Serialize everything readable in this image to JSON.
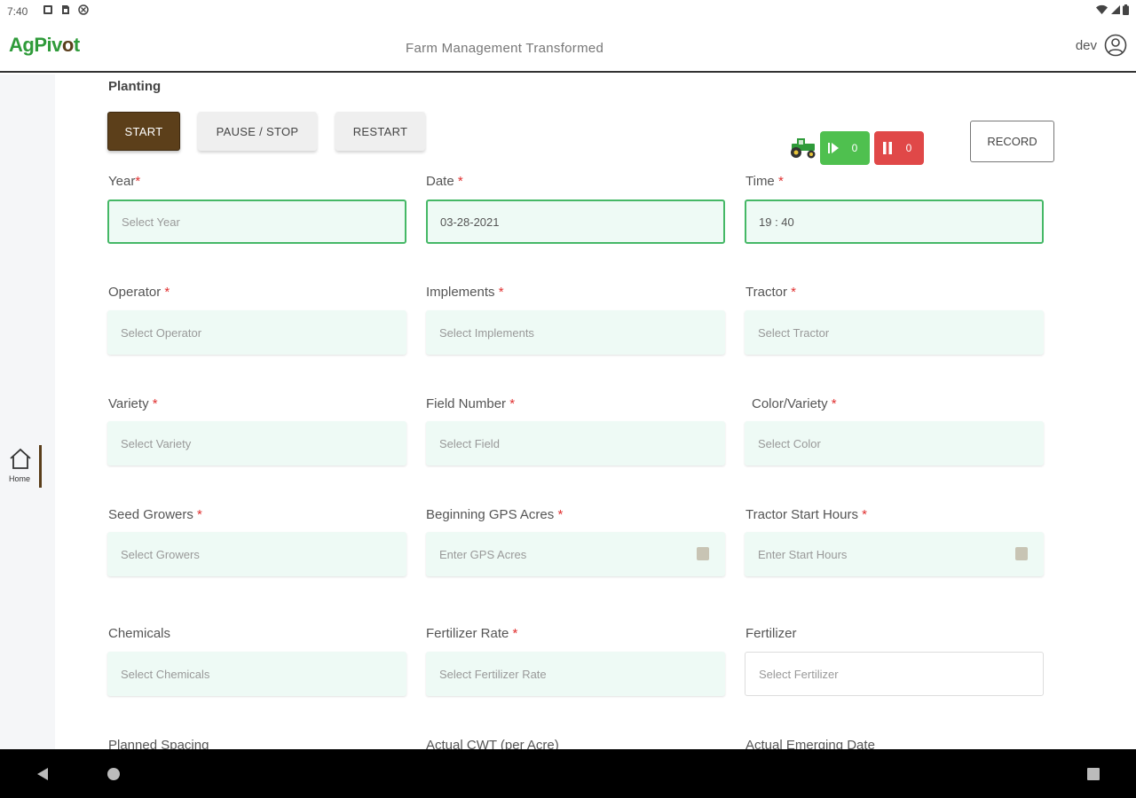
{
  "status_bar": {
    "time": "7:40"
  },
  "app": {
    "logo_part1": "Ag",
    "logo_part2": "Piv",
    "logo_part3": "o",
    "logo_part4": "t",
    "tagline": "Farm Management Transformed",
    "user_name": "dev",
    "brand_color": "#5c3f1a",
    "accent_green": "#2f9b3a"
  },
  "sidebar": {
    "home_label": "Home"
  },
  "page": {
    "title": "Planting",
    "buttons": {
      "start": "START",
      "pause_stop": "PAUSE / STOP",
      "restart": "RESTART",
      "record": "RECORD"
    },
    "counters": {
      "green_value": "0",
      "red_value": "0"
    }
  },
  "form": {
    "year": {
      "label": "Year",
      "required": "*",
      "placeholder": "Select Year"
    },
    "date": {
      "label": "Date",
      "required": "*",
      "value": "03-28-2021"
    },
    "time": {
      "label": "Time",
      "required": "*",
      "value": "19 : 40"
    },
    "operator": {
      "label": "Operator",
      "required": "*",
      "placeholder": "Select Operator"
    },
    "implements": {
      "label": "Implements",
      "required": "*",
      "placeholder": "Select Implements"
    },
    "tractor": {
      "label": "Tractor",
      "required": "*",
      "placeholder": "Select Tractor"
    },
    "variety": {
      "label": "Variety",
      "required": "*",
      "placeholder": "Select Variety"
    },
    "field_number": {
      "label": "Field Number",
      "required": "*",
      "placeholder": "Select Field"
    },
    "color_variety": {
      "label": "Color/Variety",
      "required": "*",
      "placeholder": "Select Color"
    },
    "seed_growers": {
      "label": "Seed Growers",
      "required": "*",
      "placeholder": "Select Growers"
    },
    "beginning_gps_acres": {
      "label": "Beginning GPS Acres",
      "required": "*",
      "placeholder": "Enter GPS Acres"
    },
    "tractor_start_hours": {
      "label": "Tractor Start Hours",
      "required": "*",
      "placeholder": "Enter Start Hours"
    },
    "chemicals": {
      "label": "Chemicals",
      "placeholder": "Select Chemicals"
    },
    "fertilizer_rate": {
      "label": "Fertilizer Rate",
      "required": "*",
      "placeholder": "Select Fertilizer Rate"
    },
    "fertilizer": {
      "label": "Fertilizer",
      "placeholder": "Select Fertilizer"
    },
    "planned_spacing": {
      "label": "Planned Spacing"
    },
    "actual_cwt": {
      "label": "Actual CWT (per Acre)"
    },
    "actual_emerging_date": {
      "label": "Actual Emerging Date"
    }
  }
}
